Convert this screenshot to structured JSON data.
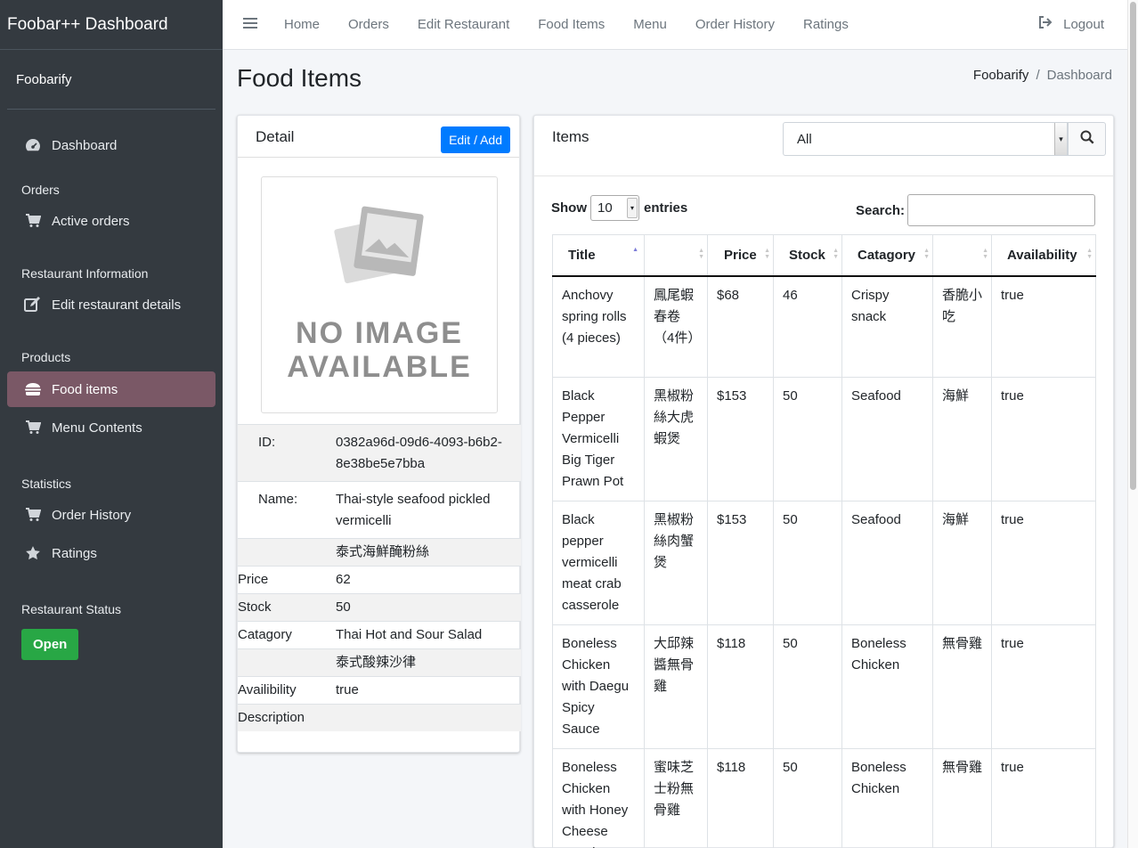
{
  "app": {
    "brand": "Foobar++ Dashboard",
    "user": "Foobarify"
  },
  "sidebar": {
    "dashboard": "Dashboard",
    "orders_header": "Orders",
    "active_orders": "Active orders",
    "info_header": "Restaurant Information",
    "edit_details": "Edit restaurant details",
    "products_header": "Products",
    "food_items": "Food items",
    "menu_contents": "Menu Contents",
    "stats_header": "Statistics",
    "order_history": "Order History",
    "ratings": "Ratings",
    "status_header": "Restaurant Status",
    "status_button": "Open"
  },
  "topnav": {
    "links": [
      "Home",
      "Orders",
      "Edit Restaurant",
      "Food Items",
      "Menu",
      "Order History",
      "Ratings"
    ],
    "logout": "Logout"
  },
  "page": {
    "title": "Food Items",
    "breadcrumb": [
      "Foobarify",
      "Dashboard"
    ]
  },
  "detail": {
    "title": "Detail",
    "edit_button": "Edit / Add",
    "no_image_line1": "NO IMAGE",
    "no_image_line2": "AVAILABLE",
    "rows": [
      {
        "label": "ID:",
        "value": "0382a96d-09d6-4093-b6b2-8e38be5e7bba"
      },
      {
        "label": "Name:",
        "value": "Thai-style seafood pickled vermicelli"
      },
      {
        "label": "",
        "value": "泰式海鮮醃粉絲"
      },
      {
        "label": "Price",
        "value": "62"
      },
      {
        "label": "Stock",
        "value": "50"
      },
      {
        "label": "Catagory",
        "value": "Thai Hot and Sour Salad"
      },
      {
        "label": "",
        "value": "泰式酸辣沙律"
      },
      {
        "label": "Availibility",
        "value": "true"
      },
      {
        "label": "Description",
        "value": ""
      }
    ]
  },
  "items": {
    "title": "Items",
    "filter_value": "All",
    "show_label": "Show",
    "entries_value": "10",
    "entries_label": "entries",
    "search_label": "Search:",
    "search_value": "",
    "columns": [
      "Title",
      "",
      "Price",
      "Stock",
      "Catagory",
      "",
      "Availability"
    ],
    "rows": [
      [
        "Anchovy spring rolls (4 pieces)",
        "鳳尾蝦春卷（4件）",
        "$68",
        "46",
        "Crispy snack",
        "香脆小吃",
        "true"
      ],
      [
        "Black Pepper Vermicelli Big Tiger Prawn Pot",
        "黑椒粉絲大虎蝦煲",
        "$153",
        "50",
        "Seafood",
        "海鮮",
        "true"
      ],
      [
        "Black pepper vermicelli meat crab casserole",
        "黑椒粉絲肉蟹煲",
        "$153",
        "50",
        "Seafood",
        "海鮮",
        "true"
      ],
      [
        "Boneless Chicken with Daegu Spicy Sauce",
        "大邱辣醬無骨雞",
        "$118",
        "50",
        "Boneless Chicken",
        "無骨雞",
        "true"
      ],
      [
        "Boneless Chicken with Honey Cheese Powder",
        "蜜味芝士粉無骨雞",
        "$118",
        "50",
        "Boneless Chicken",
        "無骨雞",
        "true"
      ]
    ]
  }
}
